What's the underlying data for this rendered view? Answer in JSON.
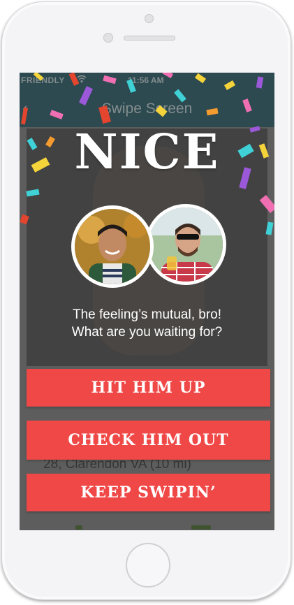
{
  "status_bar": {
    "carrier": "FRIENDLY",
    "time": "11:56 AM"
  },
  "nav": {
    "title": "Swipe Screen",
    "back_glyph": "‹"
  },
  "profile": {
    "info": "28, Clarendon VA (10 mi)"
  },
  "match": {
    "headline": "NICE",
    "message_line1": "The feeling’s mutual, bro!",
    "message_line2": "What are you waiting for?"
  },
  "buttons": {
    "hit_him_up": "HIT HIM UP",
    "check_him_out": "CHECK HIM OUT",
    "keep_swipin": "KEEP SWIPIN’"
  },
  "icons": {
    "wifi": "wifi-icon",
    "back": "chevron-left-icon"
  },
  "colors": {
    "accent": "#f04747",
    "navbar": "#3b6b74",
    "text_on_overlay": "#ffffff"
  }
}
